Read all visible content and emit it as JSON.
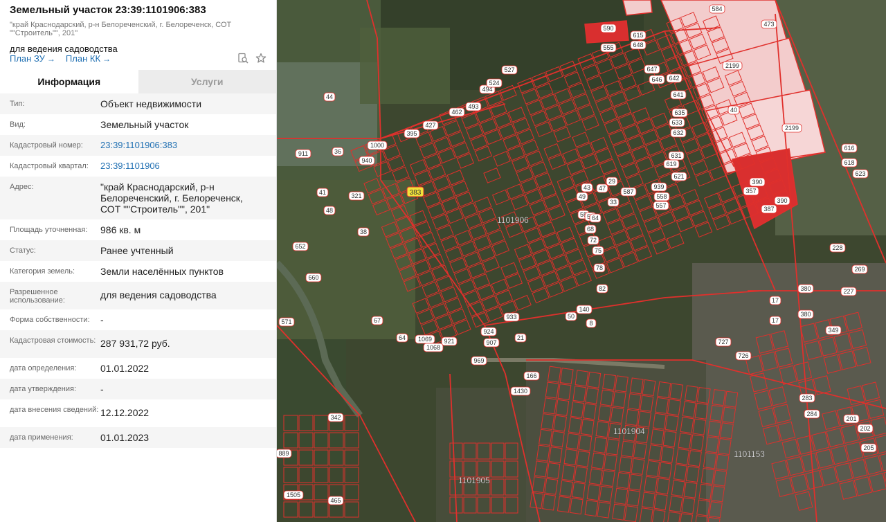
{
  "header": {
    "title": "Земельный участок 23:39:1101906:383",
    "address_short": "\"край Краснодарский, р-н Белореченский, г. Белореченск, СОТ \"\"Строитель\"\", 201\"",
    "purpose": "для ведения садоводства",
    "plan_zu": "План ЗУ",
    "plan_kk": "План КК",
    "arrow": "→"
  },
  "tabs": [
    {
      "label": "Информация"
    },
    {
      "label": "Услуги"
    }
  ],
  "info": [
    {
      "label": "Тип:",
      "value": "Объект недвижимости"
    },
    {
      "label": "Вид:",
      "value": "Земельный участок"
    },
    {
      "label": "Кадастровый номер:",
      "value": "23:39:1101906:383"
    },
    {
      "label": "Кадастровый квартал:",
      "value": "23:39:1101906"
    },
    {
      "label": "Адрес:",
      "value": "\"край Краснодарский, р-н Белореченский, г. Белореченск, СОТ \"\"Строитель\"\", 201\""
    },
    {
      "label": "Площадь уточненная:",
      "value": "986 кв. м"
    },
    {
      "label": "Статус:",
      "value": "Ранее учтенный"
    },
    {
      "label": "Категория земель:",
      "value": "Земли населённых пунктов"
    },
    {
      "label": "Разрешенное использование:",
      "value": "для ведения садоводства"
    },
    {
      "label": "Форма собственности:",
      "value": "-"
    },
    {
      "label": "Кадастровая стоимость:",
      "value": "287 931,72 руб."
    },
    {
      "label": "дата определения:",
      "value": "01.01.2022"
    },
    {
      "label": "дата утверждения:",
      "value": "-"
    },
    {
      "label": "дата внесения сведений:",
      "value": "12.12.2022"
    },
    {
      "label": "дата применения:",
      "value": "01.01.2023"
    }
  ],
  "map": {
    "colors": {
      "boundary": "#e0302c",
      "label_bg": "#ffffff",
      "selected": "#f2e23a",
      "industrial": "#f4c9c9",
      "industrial_dark": "#d92f2f"
    },
    "quarter_labels": [
      "1101906",
      "1101904",
      "1101153",
      "1101905"
    ],
    "plot_labels": [
      "584",
      "473",
      "590",
      "2199",
      "40",
      "2199",
      "390",
      "357",
      "387",
      "390",
      "44",
      "911",
      "36",
      "41",
      "48",
      "321",
      "38",
      "652",
      "660",
      "571",
      "67",
      "64",
      "342",
      "465",
      "1505",
      "889",
      "1069",
      "1068",
      "921",
      "907",
      "924",
      "969",
      "933",
      "21",
      "166",
      "1430",
      "380",
      "380",
      "227",
      "228",
      "269",
      "17",
      "17",
      "349",
      "727",
      "726",
      "283",
      "284",
      "201",
      "202",
      "205",
      "616",
      "623",
      "618",
      "383",
      "1000",
      "940",
      "395",
      "427",
      "462",
      "493",
      "494",
      "524",
      "527",
      "555",
      "615",
      "648",
      "647",
      "646",
      "642",
      "641",
      "635",
      "633",
      "632",
      "631",
      "621",
      "619",
      "939",
      "557",
      "558",
      "587",
      "33",
      "29",
      "47",
      "43",
      "49",
      "55",
      "59",
      "64",
      "68",
      "72",
      "75",
      "78",
      "82",
      "140",
      "50",
      "8"
    ],
    "link_labels": {
      "row_ids": "kadastr"
    }
  }
}
